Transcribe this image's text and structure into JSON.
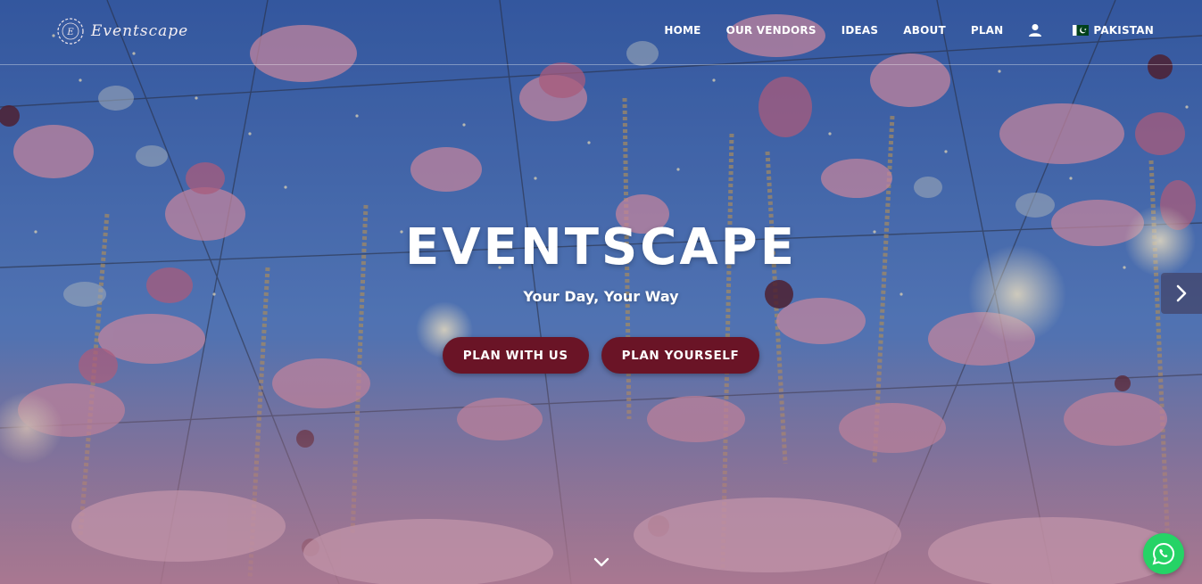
{
  "brand": {
    "logo_text": "Eventscape"
  },
  "nav": {
    "items": [
      {
        "label": "HOME"
      },
      {
        "label": "OUR VENDORS"
      },
      {
        "label": "IDEAS"
      },
      {
        "label": "ABOUT"
      },
      {
        "label": "PLAN"
      }
    ],
    "user_icon": "user-icon",
    "country": {
      "label": "PAKISTAN",
      "flag_icon": "pakistan-flag-icon"
    }
  },
  "hero": {
    "title": "EVENTSCAPE",
    "subtitle": "Your Day, Your Way",
    "buttons": [
      {
        "label": "PLAN WITH US"
      },
      {
        "label": "PLAN YOURSELF"
      }
    ],
    "next_icon": "chevron-right-icon",
    "scroll_icon": "chevron-down-icon"
  },
  "whatsapp": {
    "icon": "whatsapp-icon"
  },
  "colors": {
    "cta_background": "#6a1426",
    "whatsapp_green": "#25d366",
    "nav_text": "#ffffff",
    "sky": "#3f6fc0",
    "petal_pink": "#e7a3bb"
  }
}
